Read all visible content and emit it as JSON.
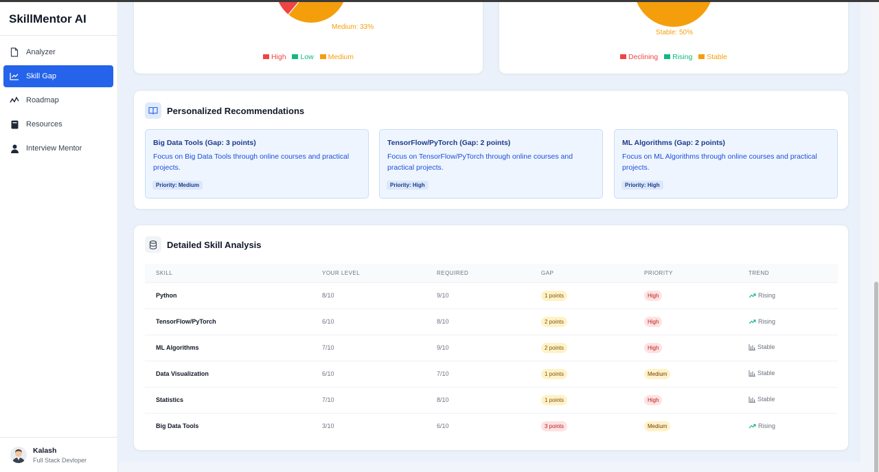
{
  "app": {
    "title": "SkillMentor AI"
  },
  "sidebar": {
    "items": [
      {
        "label": "Analyzer",
        "icon": "file-icon"
      },
      {
        "label": "Skill Gap",
        "icon": "line-chart-icon",
        "active": true
      },
      {
        "label": "Roadmap",
        "icon": "route-icon"
      },
      {
        "label": "Resources",
        "icon": "book-icon"
      },
      {
        "label": "Interview Mentor",
        "icon": "users-icon"
      }
    ]
  },
  "user": {
    "name": "Kalash",
    "role": "Full Stack Devloper"
  },
  "pie_left": {
    "slice_label": "Medium: 33%",
    "legend": [
      {
        "label": "High",
        "color": "#ef4444"
      },
      {
        "label": "Low",
        "color": "#10b981"
      },
      {
        "label": "Medium",
        "color": "#f59e0b"
      }
    ]
  },
  "pie_right": {
    "slice_label": "Stable: 50%",
    "legend": [
      {
        "label": "Declining",
        "color": "#ef4444"
      },
      {
        "label": "Rising",
        "color": "#10b981"
      },
      {
        "label": "Stable",
        "color": "#f59e0b"
      }
    ]
  },
  "recommendations": {
    "title": "Personalized Recommendations",
    "items": [
      {
        "title": "Big Data Tools (Gap: 3 points)",
        "text": "Focus on Big Data Tools through online courses and practical projects.",
        "priority": "Priority: Medium"
      },
      {
        "title": "TensorFlow/PyTorch (Gap: 2 points)",
        "text": "Focus on TensorFlow/PyTorch through online courses and practical projects.",
        "priority": "Priority: High"
      },
      {
        "title": "ML Algorithms (Gap: 2 points)",
        "text": "Focus on ML Algorithms through online courses and practical projects.",
        "priority": "Priority: High"
      }
    ]
  },
  "analysis": {
    "title": "Detailed Skill Analysis",
    "columns": [
      "SKILL",
      "YOUR LEVEL",
      "REQUIRED",
      "GAP",
      "PRIORITY",
      "TREND"
    ],
    "rows": [
      {
        "skill": "Python",
        "level": "8/10",
        "required": "9/10",
        "gap": "1 points",
        "priority": "High",
        "trend": "Rising"
      },
      {
        "skill": "TensorFlow/PyTorch",
        "level": "6/10",
        "required": "8/10",
        "gap": "2 points",
        "priority": "High",
        "trend": "Rising"
      },
      {
        "skill": "ML Algorithms",
        "level": "7/10",
        "required": "9/10",
        "gap": "2 points",
        "priority": "High",
        "trend": "Stable"
      },
      {
        "skill": "Data Visualization",
        "level": "6/10",
        "required": "7/10",
        "gap": "1 points",
        "priority": "Medium",
        "trend": "Stable"
      },
      {
        "skill": "Statistics",
        "level": "7/10",
        "required": "8/10",
        "gap": "1 points",
        "priority": "High",
        "trend": "Stable"
      },
      {
        "skill": "Big Data Tools",
        "level": "3/10",
        "required": "6/10",
        "gap": "3 points",
        "priority": "Medium",
        "trend": "Rising"
      }
    ]
  }
}
